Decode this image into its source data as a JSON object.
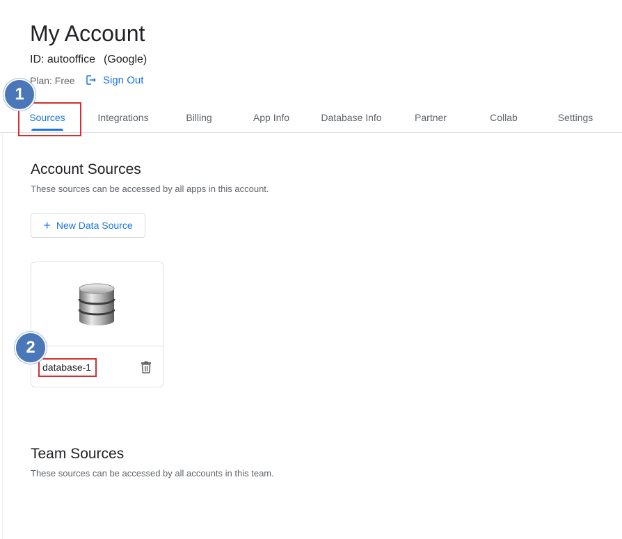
{
  "header": {
    "title": "My Account",
    "account_id": "ID: autooffice",
    "provider": "(Google)",
    "plan": "Plan: Free",
    "sign_out": "Sign Out"
  },
  "tabs": [
    {
      "label": "Sources",
      "active": true
    },
    {
      "label": "Integrations",
      "active": false
    },
    {
      "label": "Billing",
      "active": false
    },
    {
      "label": "App Info",
      "active": false
    },
    {
      "label": "Database Info",
      "active": false
    },
    {
      "label": "Partner",
      "active": false
    },
    {
      "label": "Collab",
      "active": false
    },
    {
      "label": "Settings",
      "active": false
    }
  ],
  "account_sources": {
    "title": "Account Sources",
    "description": "These sources can be accessed by all apps in this account.",
    "new_button": "New Data Source",
    "cards": [
      {
        "name": "database-1",
        "icon": "database-icon"
      }
    ]
  },
  "team_sources": {
    "title": "Team Sources",
    "description": "These sources can be accessed by all accounts in this team."
  },
  "annotations": {
    "badge_1": "1",
    "badge_2": "2"
  },
  "colors": {
    "accent": "#1a73e8",
    "highlight": "#d32f2f",
    "badge": "#4a77b8"
  }
}
